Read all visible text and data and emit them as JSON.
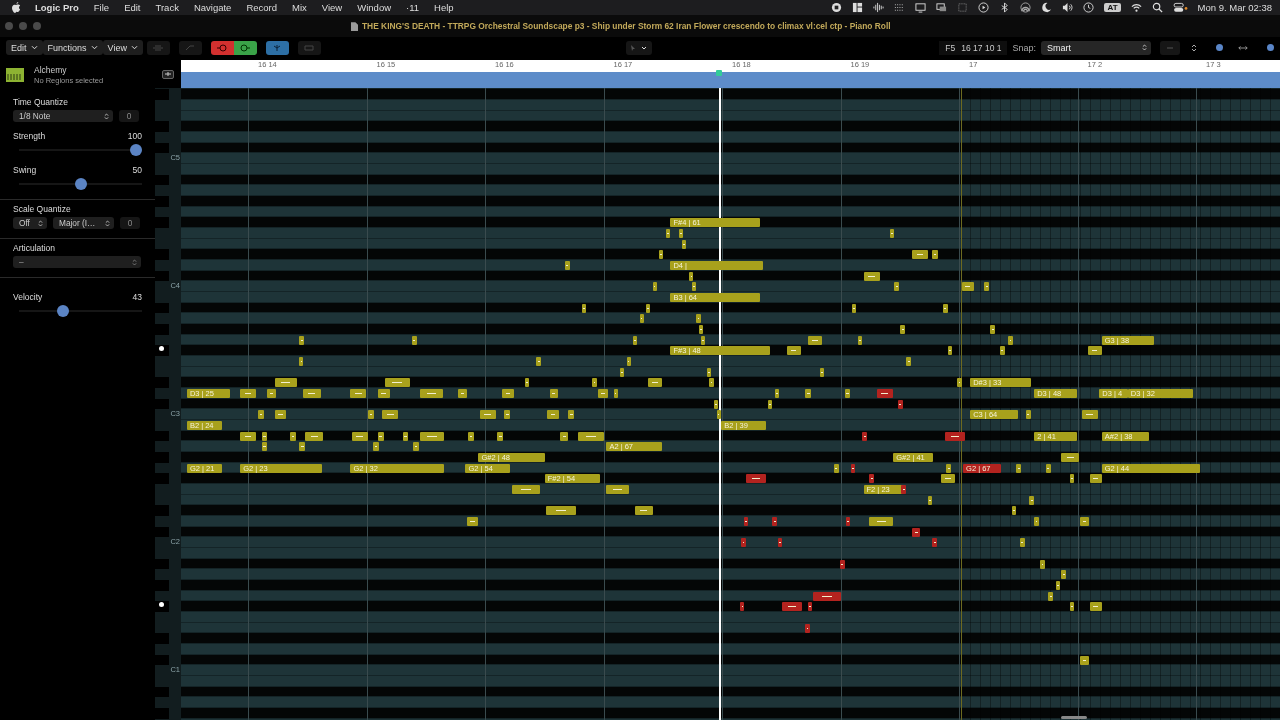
{
  "menu_bar": {
    "app": "Logic Pro",
    "items": [
      "File",
      "Edit",
      "Track",
      "Navigate",
      "Record",
      "Mix",
      "View",
      "Window",
      "·11",
      "Help"
    ],
    "input_badge": "AT",
    "clock": "Mon 9. Mar  02:38"
  },
  "window": {
    "title": "THE KING'S DEATH - TTRPG Orchestral Soundscape p3 - Ship under Storm 62  Iran Flower crescendo to climax vl:cel ctp - Piano Roll"
  },
  "toolbar": {
    "menus": [
      "Edit",
      "Functions",
      "View"
    ],
    "position": "F5",
    "locator": "16 17 10 1",
    "snap_label": "Snap:",
    "snap_value": "Smart"
  },
  "inspector": {
    "instrument": "Alchemy",
    "subtitle": "No Regions selected",
    "time_quantize": {
      "label": "Time Quantize",
      "value": "1/8 Note",
      "range": "0"
    },
    "strength": {
      "label": "Strength",
      "value": "100",
      "level": 1.0
    },
    "swing": {
      "label": "Swing",
      "value": "50",
      "level": 0.5
    },
    "scale_quantize": {
      "label": "Scale Quantize",
      "mode": "Off",
      "scale": "Major (I…",
      "range": "0"
    },
    "articulation": {
      "label": "Articulation",
      "value": "–"
    },
    "velocity": {
      "label": "Velocity",
      "value": "43",
      "level": 0.34
    }
  },
  "keyboard": {
    "labels": [
      "C5",
      "C4",
      "C3",
      "C2",
      "C1"
    ]
  },
  "ruler": {
    "labels": [
      "16 14",
      "16 15",
      "16 16",
      "16 17",
      "16 18",
      "16 19",
      "17",
      "17 2",
      "17 3"
    ]
  },
  "notes": [
    {
      "color": "#a8a11c",
      "label": "F#4 | 61"
    },
    {
      "color": "#a8a11c"
    },
    {
      "color": "#a8a11c"
    },
    {
      "color": "#a8a11c"
    },
    {
      "color": "#a8a11c"
    },
    {
      "color": "#a8a11c"
    },
    {
      "color": "#a8a11c"
    },
    {
      "color": "#a8a11c"
    },
    {
      "color": "#a8a11c"
    },
    {
      "color": "#a8a11c",
      "label": "D4 |"
    },
    {
      "color": "#a8a11c"
    },
    {
      "color": "#a8a11c"
    },
    {
      "color": "#a8a11c"
    },
    {
      "color": "#a8a11c"
    },
    {
      "color": "#a8a11c"
    },
    {
      "color": "#a8a11c"
    },
    {
      "color": "#a8a11c"
    },
    {
      "color": "#a8a11c",
      "label": "B3 | 64"
    },
    {
      "color": "#a8a11c"
    },
    {
      "color": "#a8a11c"
    },
    {
      "color": "#a8a11c"
    },
    {
      "color": "#a8a11c"
    },
    {
      "color": "#a8a11c"
    },
    {
      "color": "#a8a11c"
    },
    {
      "color": "#a8a11c"
    },
    {
      "color": "#a8a11c"
    },
    {
      "color": "#a8a11c"
    },
    {
      "color": "#a8a11c"
    },
    {
      "color": "#a8a11c"
    },
    {
      "color": "#a8a11c"
    },
    {
      "color": "#a8a11c"
    },
    {
      "color": "#a8a11c"
    },
    {
      "color": "#a8a11c"
    },
    {
      "color": "#a8a11c"
    },
    {
      "color": "#a8a11c",
      "label": "G3 | 38"
    },
    {
      "color": "#a8a11c",
      "label": "F#3 | 48"
    },
    {
      "color": "#a8a11c"
    },
    {
      "color": "#a8a11c"
    },
    {
      "color": "#a8a11c"
    },
    {
      "color": "#a8a11c"
    },
    {
      "color": "#a8a11c"
    },
    {
      "color": "#a8a11c"
    },
    {
      "color": "#a8a11c"
    },
    {
      "color": "#a8a11c"
    },
    {
      "color": "#a8a11c"
    },
    {
      "color": "#a8a11c"
    },
    {
      "color": "#a8a11c"
    },
    {
      "color": "#a8a11c"
    },
    {
      "color": "#a8a11c"
    },
    {
      "color": "#a8a11c"
    },
    {
      "color": "#a8a11c"
    },
    {
      "color": "#a8a11c"
    },
    {
      "color": "#a8a11c"
    },
    {
      "color": "#a8a11c"
    },
    {
      "color": "#a8a11c",
      "label": "D#3 | 33"
    },
    {
      "color": "#a8a11c",
      "label": "D3 | 25"
    },
    {
      "color": "#a8a11c"
    },
    {
      "color": "#a8a11c"
    },
    {
      "color": "#a8a11c"
    },
    {
      "color": "#a8a11c"
    },
    {
      "color": "#a8a11c"
    },
    {
      "color": "#a8a11c"
    },
    {
      "color": "#a8a11c"
    },
    {
      "color": "#a8a11c"
    },
    {
      "color": "#a8a11c"
    },
    {
      "color": "#a8a11c"
    },
    {
      "color": "#a8a11c"
    },
    {
      "color": "#a8a11c"
    },
    {
      "color": "#a8a11c"
    },
    {
      "color": "#a8a11c"
    },
    {
      "color": "#b3231f"
    },
    {
      "color": "#a8a11c",
      "label": "D3 | 48"
    },
    {
      "color": "#a8a11c",
      "label": "D3 | 4"
    },
    {
      "color": "#a8a11c",
      "label": "D3 | 32"
    },
    {
      "color": "#a8a11c"
    },
    {
      "color": "#a8a11c"
    },
    {
      "color": "#b3231f"
    },
    {
      "color": "#a8a11c"
    },
    {
      "color": "#a8a11c"
    },
    {
      "color": "#a8a11c"
    },
    {
      "color": "#a8a11c"
    },
    {
      "color": "#a8a11c"
    },
    {
      "color": "#a8a11c"
    },
    {
      "color": "#a8a11c"
    },
    {
      "color": "#a8a11c"
    },
    {
      "color": "#a8a11c"
    },
    {
      "color": "#a8a11c",
      "label": "C3 | 64"
    },
    {
      "color": "#a8a11c"
    },
    {
      "color": "#a8a11c"
    },
    {
      "color": "#a8a11c",
      "label": "B2 | 24"
    },
    {
      "color": "#a8a11c",
      "label": "B2 | 39"
    },
    {
      "color": "#a8a11c"
    },
    {
      "color": "#a8a11c"
    },
    {
      "color": "#a8a11c"
    },
    {
      "color": "#a8a11c"
    },
    {
      "color": "#a8a11c"
    },
    {
      "color": "#a8a11c"
    },
    {
      "color": "#a8a11c"
    },
    {
      "color": "#a8a11c"
    },
    {
      "color": "#a8a11c"
    },
    {
      "color": "#a8a11c"
    },
    {
      "color": "#a8a11c"
    },
    {
      "color": "#a8a11c"
    },
    {
      "color": "#b3231f"
    },
    {
      "color": "#b3231f"
    },
    {
      "color": "#a8a11c",
      "label": "2 | 41"
    },
    {
      "color": "#a8a11c",
      "label": "A#2 | 38"
    },
    {
      "color": "#a8a11c"
    },
    {
      "color": "#a8a11c"
    },
    {
      "color": "#a8a11c"
    },
    {
      "color": "#a8a11c"
    },
    {
      "color": "#a8a11c",
      "label": "A2 | 67"
    },
    {
      "color": "#a8a11c",
      "label": "G#2 | 48"
    },
    {
      "color": "#a8a11c",
      "label": "G#2 | 41"
    },
    {
      "color": "#a8a11c"
    },
    {
      "color": "#a8a11c",
      "label": "G2 | 21"
    },
    {
      "color": "#a8a11c",
      "label": "G2 | 23"
    },
    {
      "color": "#a8a11c",
      "label": "G2 | 32"
    },
    {
      "color": "#a8a11c",
      "label": "G2 | 54"
    },
    {
      "color": "#a8a11c"
    },
    {
      "color": "#b3231f"
    },
    {
      "color": "#a8a11c"
    },
    {
      "color": "#b3231f",
      "label": "G2 | 67"
    },
    {
      "color": "#a8a11c"
    },
    {
      "color": "#a8a11c"
    },
    {
      "color": "#a8a11c",
      "label": "G2 | 44"
    },
    {
      "color": "#a8a11c",
      "label": "F#2 | 54"
    },
    {
      "color": "#b3231f"
    },
    {
      "color": "#b3231f"
    },
    {
      "color": "#a8a11c"
    },
    {
      "color": "#a8a11c"
    },
    {
      "color": "#a8a11c"
    },
    {
      "color": "#a8a11c"
    },
    {
      "color": "#a8a11c"
    },
    {
      "color": "#a8a11c",
      "label": "F2 | 23"
    },
    {
      "color": "#b3231f"
    },
    {
      "color": "#a8a11c"
    },
    {
      "color": "#a8a11c"
    },
    {
      "color": "#a8a11c"
    },
    {
      "color": "#a8a11c"
    },
    {
      "color": "#a8a11c"
    },
    {
      "color": "#a8a11c"
    },
    {
      "color": "#b3231f"
    },
    {
      "color": "#b3231f"
    },
    {
      "color": "#b3231f"
    },
    {
      "color": "#a8a11c"
    },
    {
      "color": "#a8a11c"
    },
    {
      "color": "#a8a11c"
    },
    {
      "color": "#b3231f"
    },
    {
      "color": "#b3231f"
    },
    {
      "color": "#b3231f"
    },
    {
      "color": "#b3231f"
    },
    {
      "color": "#a8a11c"
    },
    {
      "color": "#b3231f"
    },
    {
      "color": "#a8a11c"
    },
    {
      "color": "#a8a11c"
    },
    {
      "color": "#a8a11c"
    },
    {
      "color": "#b3231f"
    },
    {
      "color": "#a8a11c"
    },
    {
      "color": "#b3231f"
    },
    {
      "color": "#b3231f"
    },
    {
      "color": "#b3231f"
    },
    {
      "color": "#a8a11c"
    },
    {
      "color": "#a8a11c"
    },
    {
      "color": "#b3231f"
    },
    {
      "color": "#a8a11c"
    }
  ]
}
